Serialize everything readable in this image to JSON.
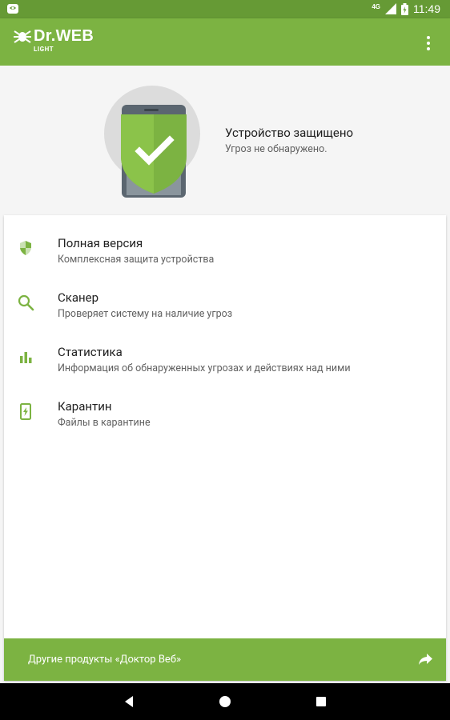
{
  "status_bar": {
    "time": "11:49",
    "network": "4G",
    "icons": [
      "drweb-notification-icon",
      "signal-icon",
      "battery-icon"
    ]
  },
  "toolbar": {
    "logo_text": "Dr.WEB",
    "logo_subtext": "LIGHT",
    "menu_icon": "overflow-menu-icon"
  },
  "hero": {
    "title": "Устройство защищено",
    "subtitle": "Угроз не обнаружено."
  },
  "menu": {
    "items": [
      {
        "title": "Полная версия",
        "desc": "Комплексная защита устройства",
        "icon": "shield-icon"
      },
      {
        "title": "Сканер",
        "desc": "Проверяет систему на наличие угроз",
        "icon": "search-icon"
      },
      {
        "title": "Статистика",
        "desc": "Информация об обнаруженных угрозах и действиях над ними",
        "icon": "bar-chart-icon"
      },
      {
        "title": "Карантин",
        "desc": "Файлы в карантине",
        "icon": "quarantine-icon"
      }
    ]
  },
  "footer": {
    "label": "Другие продукты «Доктор Веб»",
    "icon": "share-icon"
  },
  "nav_bar": {
    "buttons": [
      "back-icon",
      "home-icon",
      "recents-icon"
    ]
  },
  "colors": {
    "primary": "#7cb342",
    "primary_dark": "#669a35",
    "text_primary": "#212121",
    "text_secondary": "#616161"
  }
}
